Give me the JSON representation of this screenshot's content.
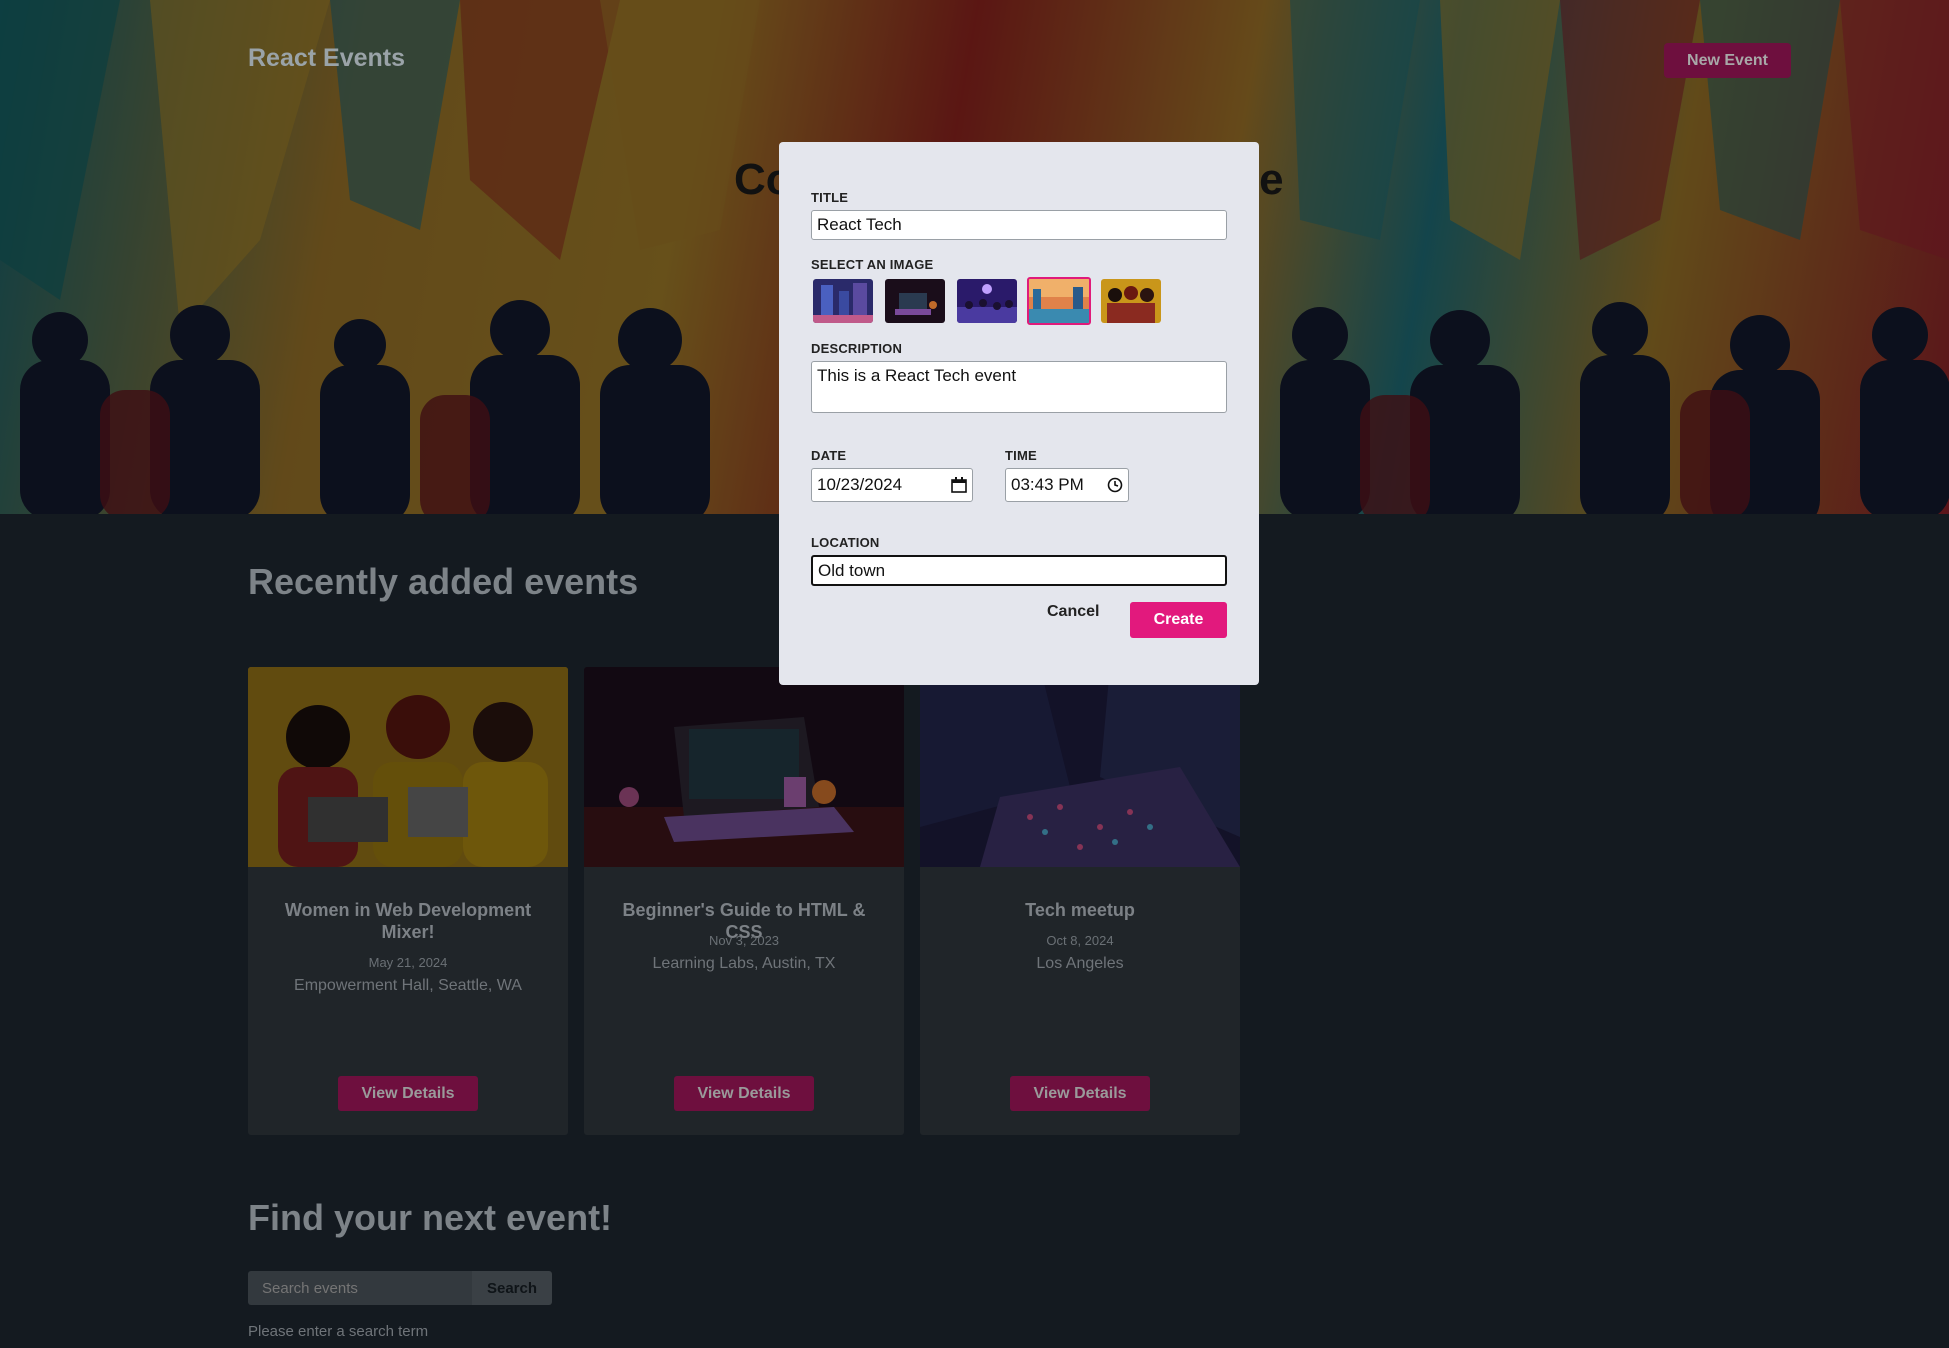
{
  "header": {
    "brand": "React Events",
    "new_event_label": "New Event"
  },
  "hero": {
    "heading_left": "Co",
    "heading_right": "ole"
  },
  "sections": {
    "recent_title": "Recently added events",
    "find_title": "Find your next event!"
  },
  "events": [
    {
      "title": "Women in Web Development Mixer!",
      "date": "May 21, 2024",
      "location": "Empowerment Hall, Seattle, WA",
      "button": "View Details"
    },
    {
      "title": "Beginner's Guide to HTML & CSS",
      "date": "Nov 3, 2023",
      "location": "Learning Labs, Austin, TX",
      "button": "View Details"
    },
    {
      "title": "Tech meetup",
      "date": "Oct 8, 2024",
      "location": "Los Angeles",
      "button": "View Details"
    }
  ],
  "search": {
    "placeholder": "Search events",
    "button": "Search",
    "hint": "Please enter a search term"
  },
  "modal": {
    "title_label": "TITLE",
    "title_value": "React Tech",
    "image_label": "SELECT AN IMAGE",
    "selected_image": 4,
    "description_label": "DESCRIPTION",
    "description_value": "This is a React Tech event",
    "date_label": "DATE",
    "date_value": "10/23/2024",
    "time_label": "TIME",
    "time_value": "03:43 PM",
    "location_label": "LOCATION",
    "location_value": "Old town",
    "cancel_label": "Cancel",
    "create_label": "Create"
  },
  "colors": {
    "accent": "#e2197d",
    "accent_dim": "#6e0f3e",
    "page_bg": "#141a20"
  }
}
